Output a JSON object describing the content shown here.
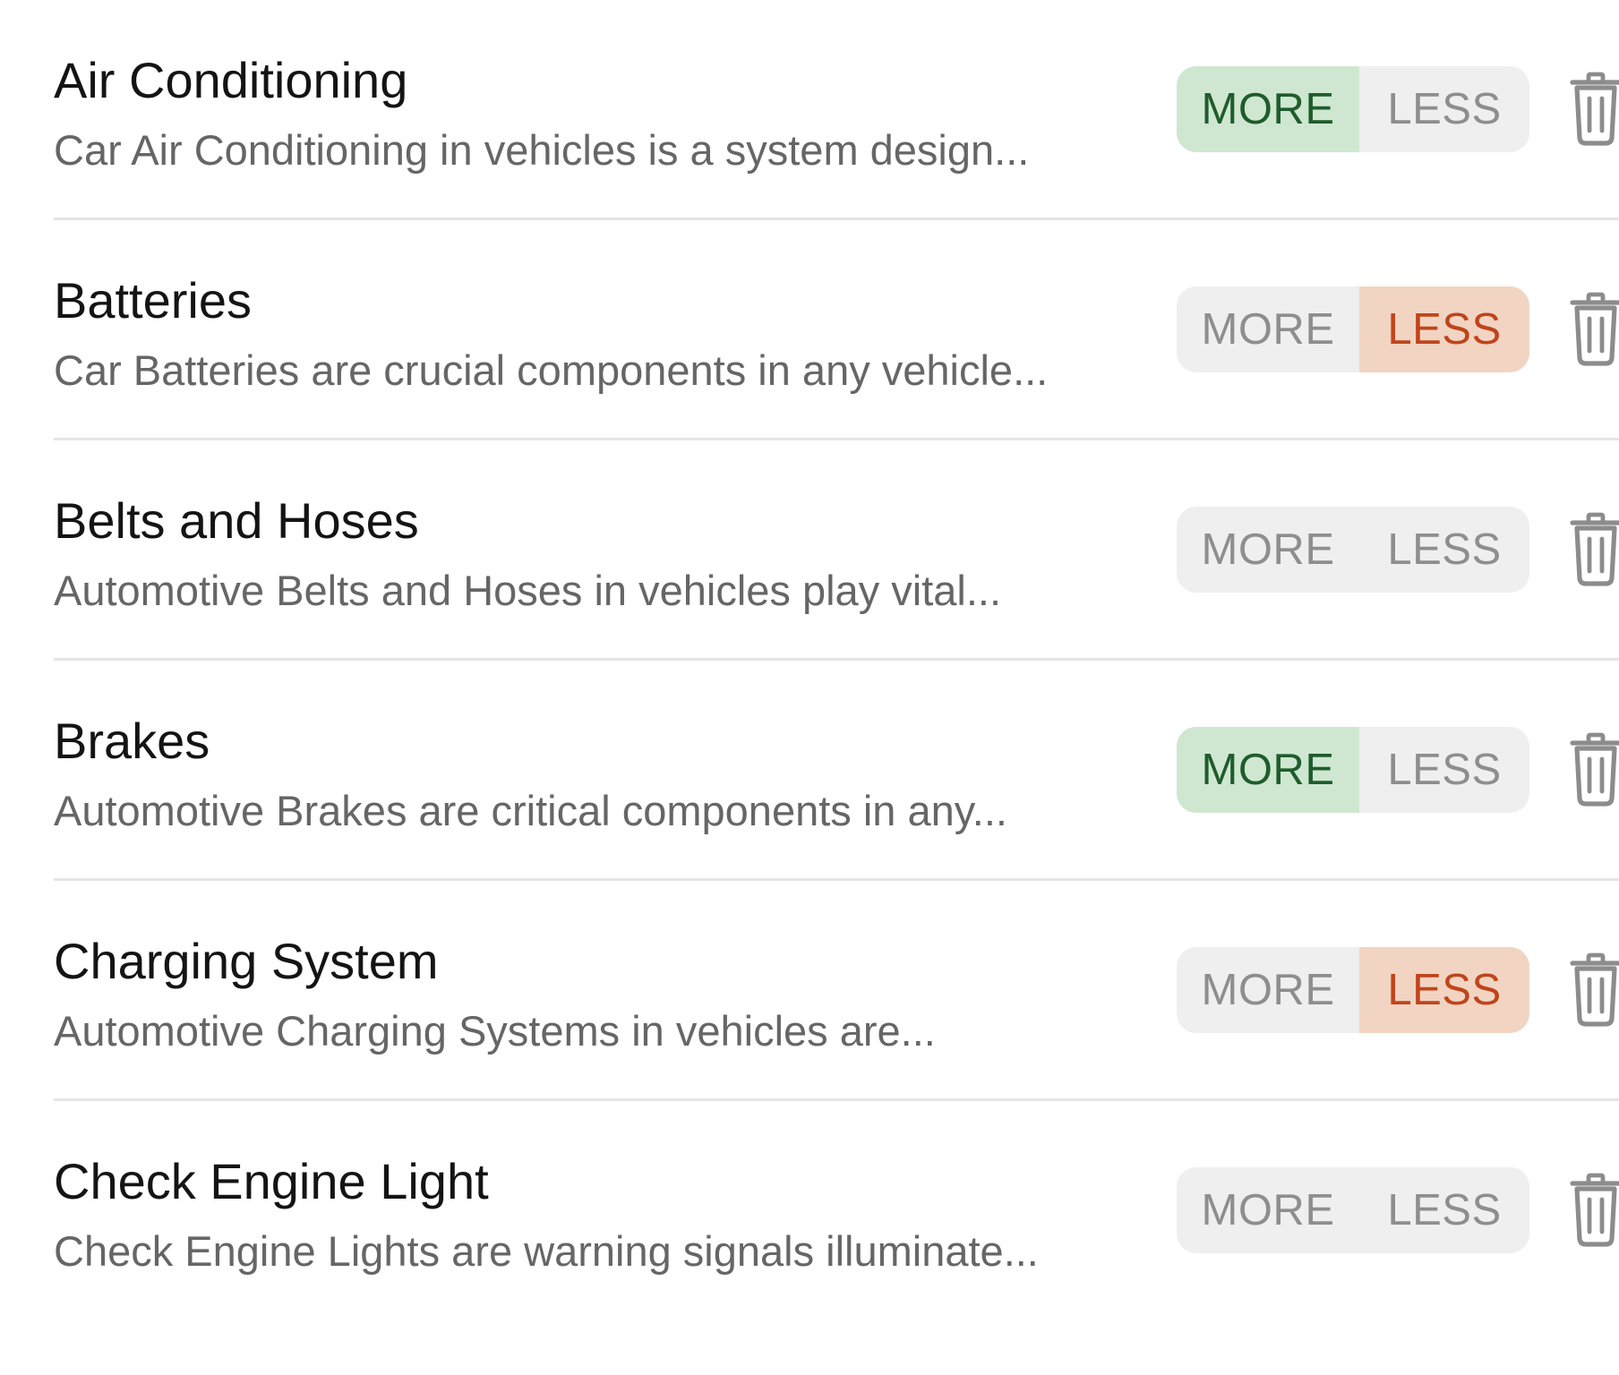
{
  "labels": {
    "more": "MORE",
    "less": "LESS"
  },
  "colors": {
    "more_active_bg": "#cfe7d1",
    "more_active_text": "#1f5c2c",
    "less_active_bg": "#f2d4c3",
    "less_active_text": "#c0441a",
    "inactive_bg": "#efefef",
    "inactive_text": "#8e8e8e"
  },
  "items": [
    {
      "title": "Air Conditioning",
      "description": "Car Air Conditioning in vehicles is a system design...",
      "selected": "more"
    },
    {
      "title": "Batteries",
      "description": "Car Batteries are crucial components in any vehicle...",
      "selected": "less"
    },
    {
      "title": "Belts and Hoses",
      "description": "Automotive Belts and Hoses in vehicles play vital...",
      "selected": "none"
    },
    {
      "title": "Brakes",
      "description": "Automotive Brakes are critical components in any...",
      "selected": "more"
    },
    {
      "title": "Charging System",
      "description": "Automotive Charging Systems in vehicles are...",
      "selected": "less"
    },
    {
      "title": "Check Engine Light",
      "description": "Check Engine Lights are warning signals illuminate...",
      "selected": "none"
    }
  ]
}
